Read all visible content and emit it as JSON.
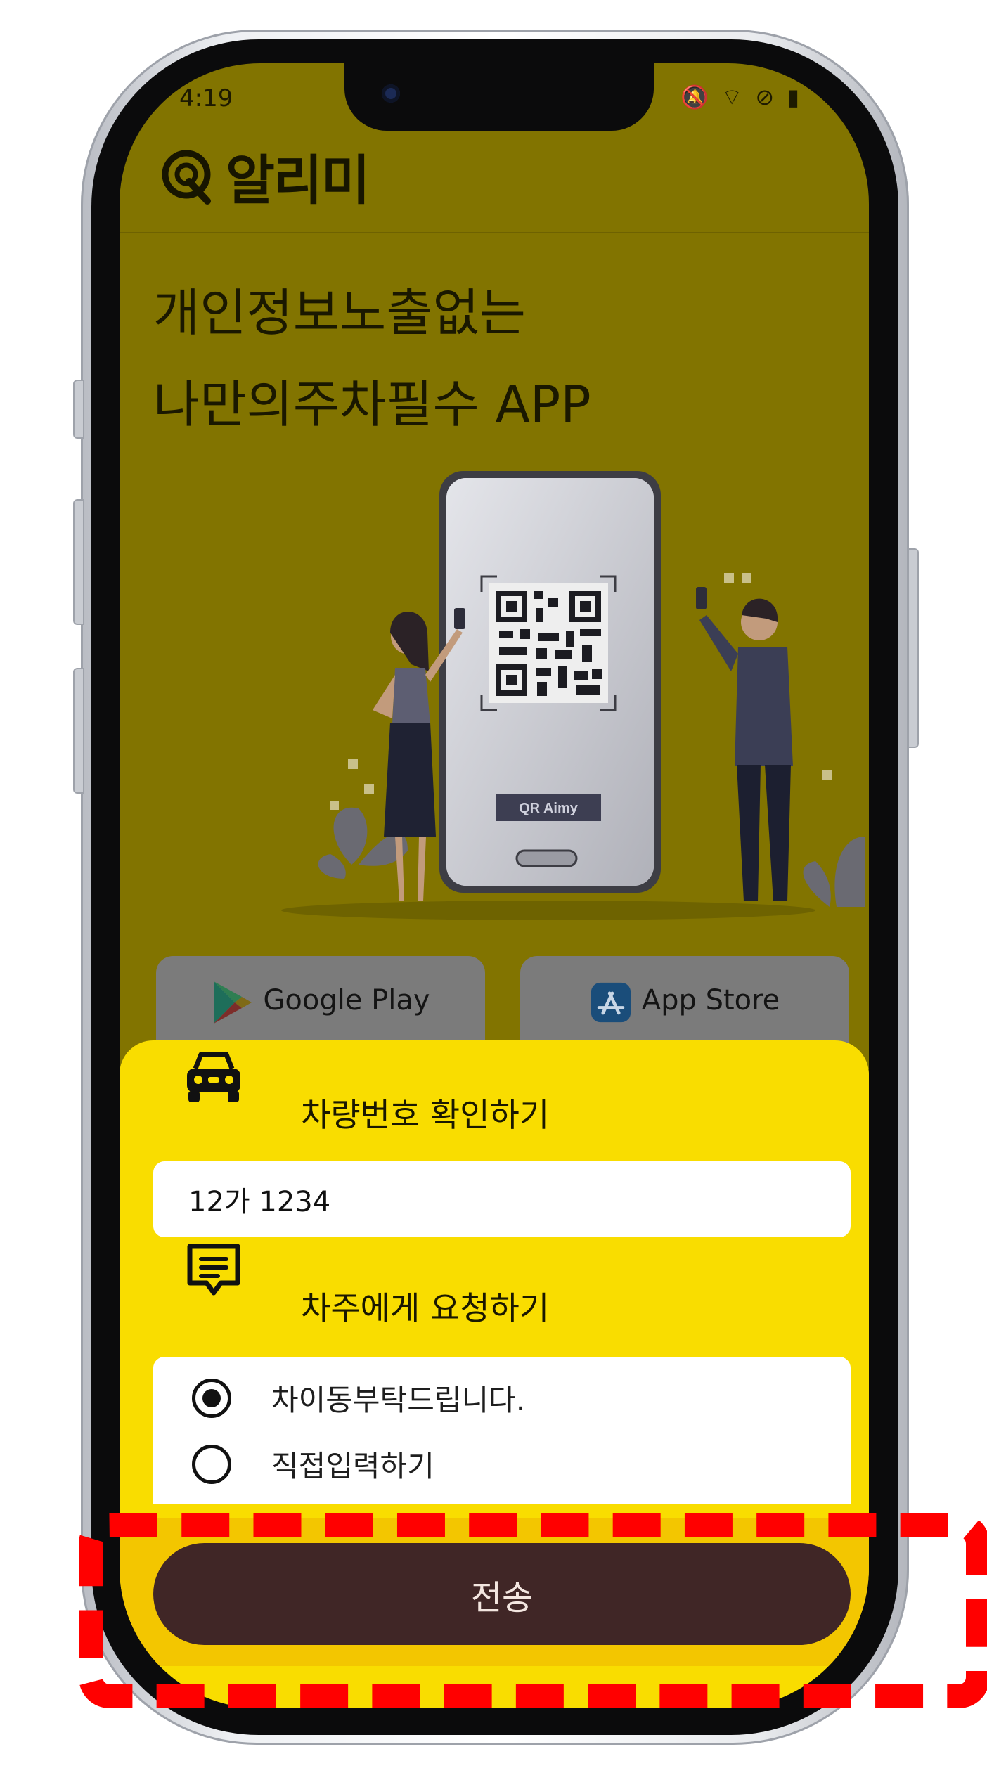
{
  "status_bar": {
    "time": "4:19",
    "icons_text": "🔕 ⌔ ⊘ ▮"
  },
  "header": {
    "logo_text": "알리미"
  },
  "hero": {
    "line1": "개인정보노출없는",
    "line2": "나만의주차필수 APP"
  },
  "illustration": {
    "qr_caption": "QR Aimy"
  },
  "stores": {
    "google_label": "Google Play",
    "apple_label": "App Store"
  },
  "sheet": {
    "car_section_label": "차량번호 확인하기",
    "plate_value": "12가 1234",
    "request_section_label": "차주에게 요청하기",
    "options": [
      {
        "label": "차이동부탁드립니다.",
        "selected": true
      },
      {
        "label": "직접입력하기",
        "selected": false
      }
    ],
    "send_label": "전송"
  },
  "colors": {
    "sheet_yellow": "#f9dd00",
    "dim_backdrop": "#827400",
    "send_button": "#402626",
    "highlight_red": "#ff0000"
  }
}
